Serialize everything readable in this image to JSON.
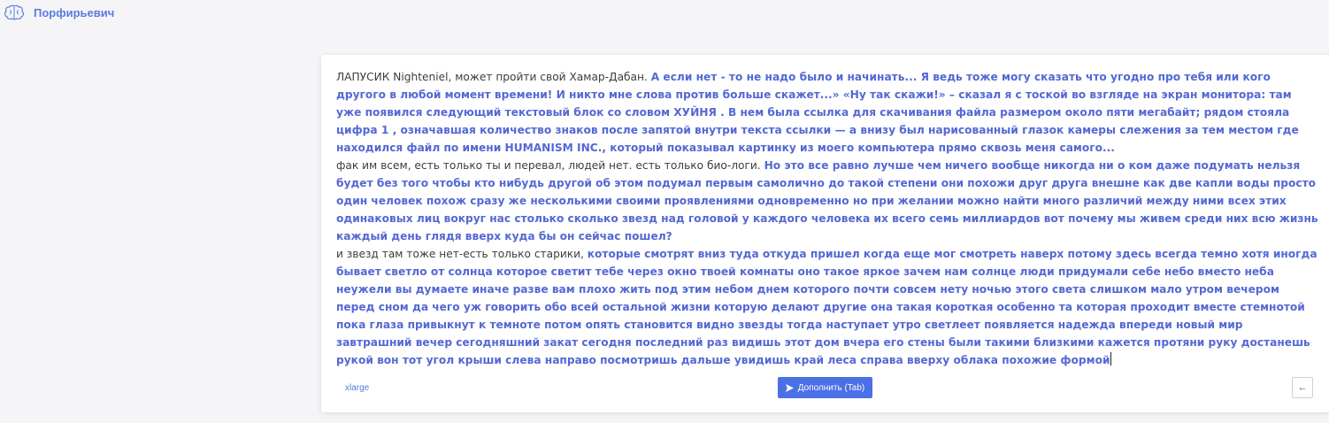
{
  "header": {
    "brand_name": "Порфирьевич",
    "logo_icon": "brain-icon"
  },
  "editor": {
    "paragraphs": [
      {
        "user_text": "ЛАПУСИК  Nighteniel, может пройти свой Хамар-Дабан. ",
        "generated_text": "А если нет - то не надо было и начинать... Я ведь тоже могу сказать что угодно про тебя или кого другого в любой момент времени! И никто мне слова против больше скажет...» «Ну так скажи!» – сказал я с тоской во взгляде на экран монитора: там уже появился следующий текстовый блок со словом ХУЙНЯ . В нем была ссылка для скачивания файла размером около пяти мегабайт; рядом стояла цифра 1 , означавшая количество знаков после запятой внутри текста ссылки — а внизу был нарисованный глазок камеры слежения за тем местом где находился файл по имени HUMANISM INC., который показывал картинку из моего компьютера прямо сквозь меня самого..."
      },
      {
        "user_text": "фак им всем, есть только ты и перевал, людей нет. есть только био-логи. ",
        "generated_text": "Но это все равно лучше чем ничего вообще никогда ни о ком даже подумать нельзя будет без того чтобы кто нибудь другой об этом подумал первым самолично до такой степени они похожи друг друга внешне как две капли воды просто один человек похож сразу же несколькими своими проявлениями одновременно но при желании можно найти много различий между ними всех этих одинаковых лиц вокруг нас столько сколько звезд над головой у каждого человека их всего семь миллиардов вот почему мы живем среди них всю жизнь каждый день глядя вверх куда бы он сейчас пошел?"
      },
      {
        "user_text": "и звезд там тоже нет-есть только старики,  ",
        "generated_text": "которые смотрят вниз туда откуда пришел когда еще мог смотреть наверх потому здесь всегда темно хотя иногда бывает светло от солнца которое светит тебе через окно твоей комнаты оно такое яркое зачем нам солнце люди придумали себе небо вместо неба неужели вы думаете иначе разве вам плохо жить под этим небом днем которого почти совсем нету ночью этого света слишком мало утром вечером перед сном да чего уж говорить обо всей остальной жизни которую делают другие она такая короткая особенно та которая проходит вместе стемнотой пока глаза привыкнут к темноте потом опять становится видно звезды тогда наступает утро светлеет появляется надежда впереди новый мир завтрашний вечер сегодняшний закат сегодня последний раз видишь этот дом вчера его стены были такими близкими кажется протяни руку достанешь рукой вон тот угол крыши слева направо посмотришь дальше увидишь край леса справа вверху облака похожие формой"
      }
    ]
  },
  "footer": {
    "model_label": "xlarge",
    "complete_button_label": "Дополнить (Tab)",
    "complete_button_icon": "send-icon",
    "back_button_icon": "arrow-left-icon",
    "back_button_glyph": "←"
  },
  "colors": {
    "accent": "#4a6fe6",
    "generated_text": "#5468d4",
    "brand": "#5a7be0"
  }
}
